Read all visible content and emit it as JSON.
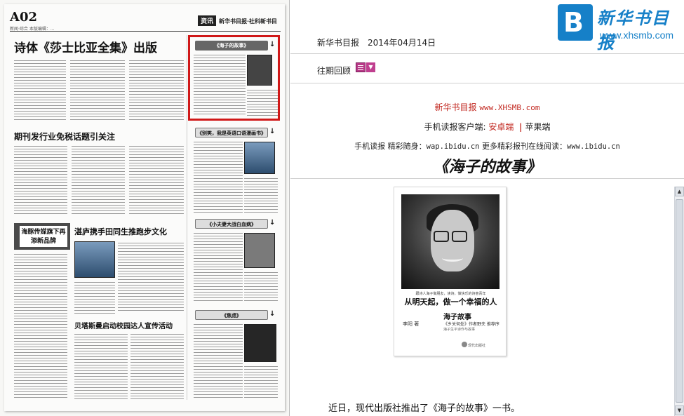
{
  "paper": {
    "page_number": "A02",
    "page_meta": "新闻·综合  本版编辑：...",
    "masthead_tag": "资讯",
    "masthead_text": "新华书目报·社科新书目",
    "headline_main": "诗体《莎士比亚全集》出版",
    "headline_2": "期刊发行业免税话题引关注",
    "headline_3": "湛庐携手田同生推跑步文化",
    "headline_4": "贝塔斯曼启动校园达人宣传活动",
    "ad_text": "海豚传媒旗下再添新品牌",
    "section_1": "《海子的故事》",
    "section_2": "《别笑，我是英语口语漫画书》",
    "section_3": "《小夫妻大战白血病》",
    "section_4": "《焦虑》",
    "arrow": "↓"
  },
  "logo": {
    "mark_letter": "B",
    "name": "新华书目报",
    "url": "www.xhsmb.com"
  },
  "dateline": {
    "paper_name": "新华书目报",
    "date": "2014年04月14日"
  },
  "past_issues": {
    "label": "往期回顾",
    "dropdown_glyph": "▼"
  },
  "brand_line": {
    "name": "新华书目报",
    "url": "www.XHSMB.com"
  },
  "clients": {
    "label": "手机读报客户端:",
    "android": "安卓端",
    "separator": "|",
    "apple": "苹果端"
  },
  "mobile": {
    "prefix": "手机读报 精彩随身：",
    "wap": "wap.ibidu.cn",
    "middle": " 更多精彩报刊在线阅读：",
    "web": "www.ibidu.cn"
  },
  "article": {
    "title": "《海子的故事》",
    "body_first_line": "近日，现代出版社推出了《海子的故事》一书。"
  },
  "book_cover": {
    "tagline": "跟诗人海子做朋友，读诗，做快乐的诗意青年",
    "big_title": "从明天起，做一个幸福的人",
    "title": "海子故事",
    "subtitle": "《乡关何处》作者野夫 推荐序",
    "note": "海子生平诗作与故事",
    "author": "李阳 著",
    "publisher": "现代出版社"
  },
  "scrollbar": {
    "up": "▲",
    "down": "▼"
  }
}
